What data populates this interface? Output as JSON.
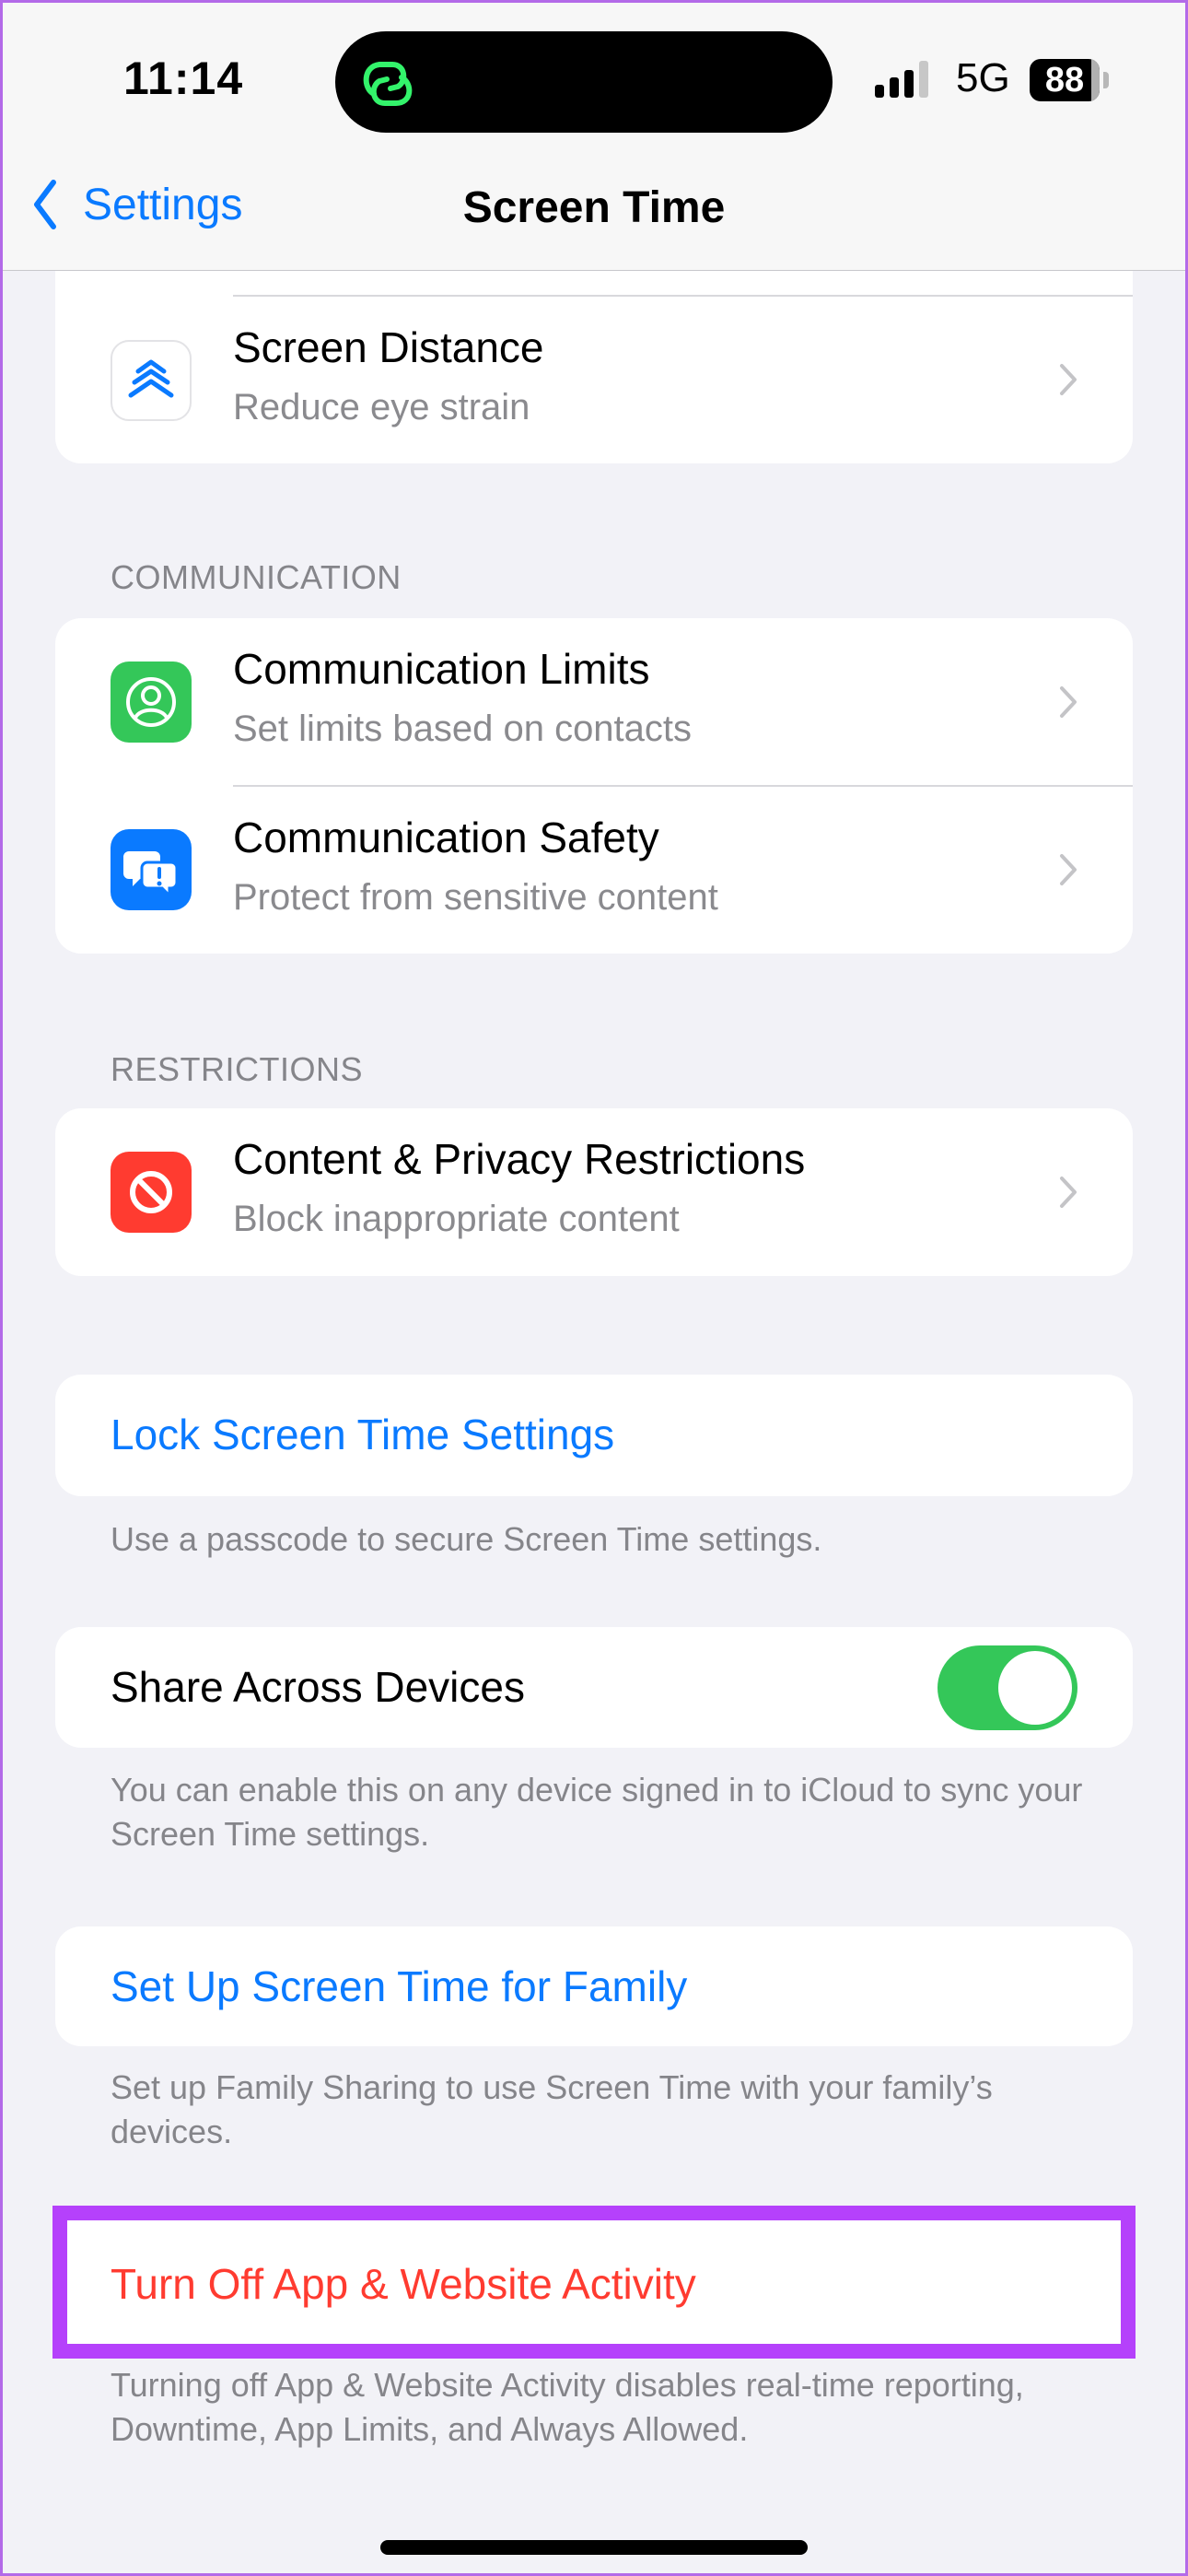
{
  "status_bar": {
    "time": "11:14",
    "network": "5G",
    "battery": "88",
    "signal_bars_active": 3,
    "signal_bars_total": 4,
    "island_activity_icon": "link-icon"
  },
  "nav": {
    "back_label": "Settings",
    "title": "Screen Time"
  },
  "sections": {
    "top": {
      "items": [
        {
          "title": "Screen Distance",
          "subtitle": "Reduce eye strain",
          "icon": "double-chevron-up-icon",
          "icon_color": "#0a7aff"
        }
      ]
    },
    "communication": {
      "header": "COMMUNICATION",
      "items": [
        {
          "title": "Communication Limits",
          "subtitle": "Set limits based on contacts",
          "icon": "person-circle-icon",
          "icon_bg": "#34c759"
        },
        {
          "title": "Communication Safety",
          "subtitle": "Protect from sensitive content",
          "icon": "chat-bubbles-alert-icon",
          "icon_bg": "#0a7aff"
        }
      ]
    },
    "restrictions": {
      "header": "RESTRICTIONS",
      "items": [
        {
          "title": "Content & Privacy Restrictions",
          "subtitle": "Block inappropriate content",
          "icon": "prohibited-icon",
          "icon_bg": "#ff3b30"
        }
      ]
    },
    "lock": {
      "label": "Lock Screen Time Settings",
      "footer": "Use a passcode to secure Screen Time settings."
    },
    "share": {
      "label": "Share Across Devices",
      "toggle_on": true,
      "footer": "You can enable this on any device signed in to iCloud to sync your Screen Time settings."
    },
    "family": {
      "label": "Set Up Screen Time for Family",
      "footer": "Set up Family Sharing to use Screen Time with your family’s devices."
    },
    "turn_off": {
      "label": "Turn Off App & Website Activity",
      "footer": "Turning off App & Website Activity disables real-time reporting, Downtime, App Limits, and Always Allowed."
    }
  },
  "colors": {
    "accent_blue": "#0a7aff",
    "destructive_red": "#ff3b30",
    "toggle_green": "#34c759",
    "highlight_purple": "#b541fb",
    "background": "#f2f2f7"
  }
}
